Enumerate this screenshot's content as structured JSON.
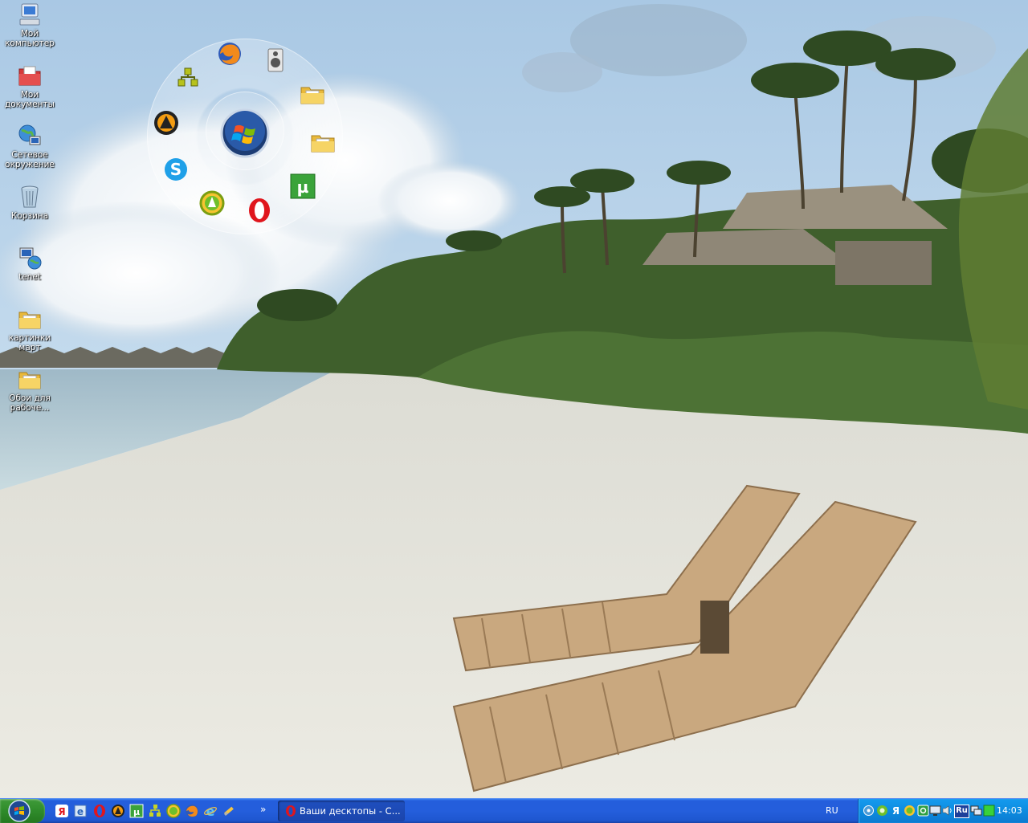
{
  "desktop": {
    "icons": [
      {
        "label": "Мой компьютер",
        "icon": "my-computer-icon"
      },
      {
        "label": "Мои документы",
        "icon": "my-documents-icon"
      },
      {
        "label": "Сетевое окружение",
        "icon": "network-icon"
      },
      {
        "label": "Корзина",
        "icon": "recycle-bin-icon"
      },
      {
        "label": "tenet",
        "icon": "tenet-icon"
      },
      {
        "label": "картинки март",
        "icon": "folder-icon"
      },
      {
        "label": "Обои для рабоче...",
        "icon": "folder-icon"
      }
    ]
  },
  "launcher": {
    "center_icon": "windows-logo-icon",
    "items": [
      "firefox-icon",
      "speaker-icon",
      "folder-icon",
      "folder-icon",
      "utorrent-icon",
      "opera-icon",
      "agent-icon",
      "skype-icon",
      "aimp-icon",
      "ftp-tree-icon"
    ]
  },
  "taskbar": {
    "start_icon": "windows-logo-icon",
    "quick_launch": [
      "yandex-icon",
      "ie-shield-icon",
      "opera-icon",
      "aimp-icon",
      "utorrent-icon",
      "ftp-tree-icon",
      "agent-icon",
      "firefox-icon",
      "ie-icon",
      "tool-icon"
    ],
    "more_label": "»",
    "task_button": {
      "label": "Ваши десктопы - С...",
      "icon": "opera-icon"
    },
    "language": "RU",
    "tray_lang": "Ru",
    "clock": "14:03"
  },
  "colors": {
    "taskbar_blue": "#245edc",
    "tray_blue": "#0d8ce0",
    "start_green": "#2f8b2b"
  }
}
